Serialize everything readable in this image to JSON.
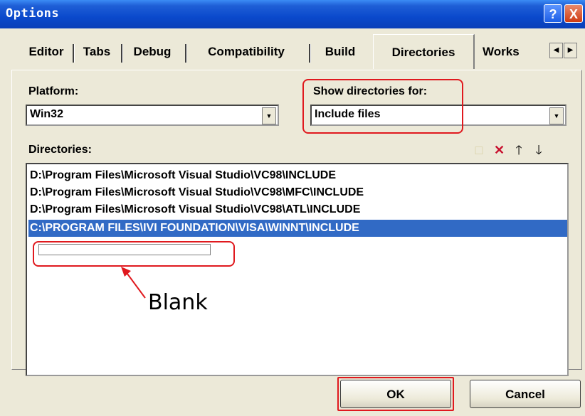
{
  "window": {
    "title": "Options",
    "help_glyph": "?",
    "close_glyph": "X"
  },
  "tabs": [
    {
      "label": "Editor"
    },
    {
      "label": "Tabs"
    },
    {
      "label": "Debug"
    },
    {
      "label": "Compatibility"
    },
    {
      "label": "Build"
    },
    {
      "label": "Directories"
    },
    {
      "label": "Works"
    }
  ],
  "active_tab": "Directories",
  "platform": {
    "label": "Platform:",
    "value": "Win32"
  },
  "show_dirs": {
    "label": "Show directories for:",
    "value": "Include files"
  },
  "directories": {
    "label": "Directories:",
    "items": [
      "D:\\Program Files\\Microsoft Visual Studio\\VC98\\INCLUDE",
      "D:\\Program Files\\Microsoft Visual Studio\\VC98\\MFC\\INCLUDE",
      "D:\\Program Files\\Microsoft Visual Studio\\VC98\\ATL\\INCLUDE",
      "C:\\PROGRAM FILES\\IVI FOUNDATION\\VISA\\WINNT\\INCLUDE"
    ],
    "selected_index": 3,
    "toolbar_icons": [
      "new-folder-icon",
      "delete-icon",
      "move-up-icon",
      "move-down-icon"
    ]
  },
  "annotation": {
    "text": "Blank",
    "color": "#e0191e"
  },
  "buttons": {
    "ok": "OK",
    "cancel": "Cancel"
  },
  "colors": {
    "titlebar": "#0a49cc",
    "selection": "#316ac5",
    "highlight_border": "#e0191e",
    "dialog_bg": "#ece9d8"
  }
}
